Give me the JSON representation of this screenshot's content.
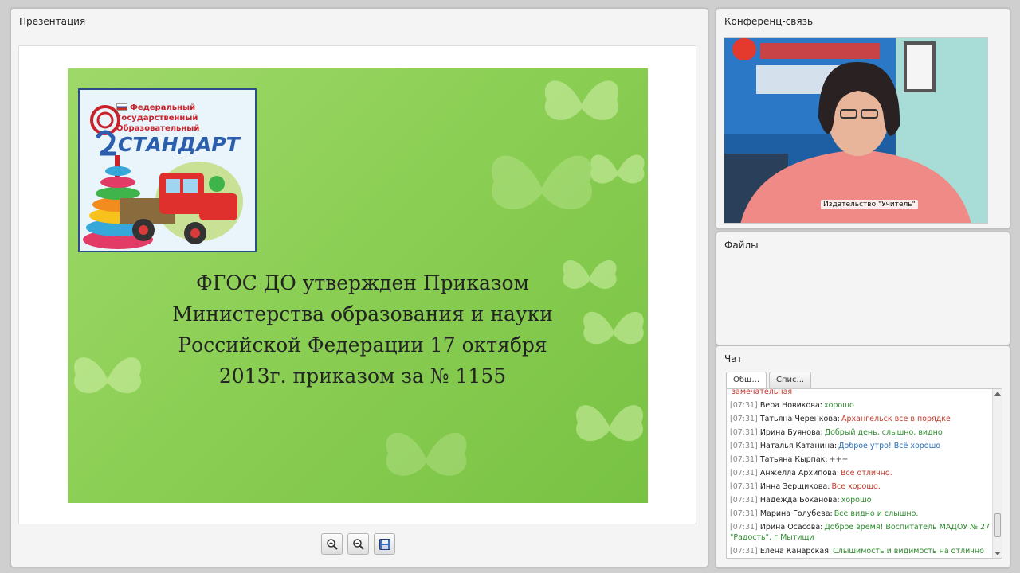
{
  "presentation": {
    "title": "Презентация",
    "slide": {
      "logo": {
        "line1": "Федеральный",
        "line2": "Государственный",
        "line3": "Образовательный",
        "word": "СТАНДАРТ"
      },
      "lines": [
        "ФГОС ДО утвержден Приказом",
        "Министерства образования и науки",
        "Российской Федерации 17 октября",
        "2013г. приказом за № 1155"
      ]
    },
    "toolbar": {
      "zoom_in": "zoom-in-icon",
      "zoom_out": "zoom-out-icon",
      "save": "save-icon"
    }
  },
  "conference": {
    "title": "Конференц-связь",
    "speaker_label": "Издательство \"Учитель\""
  },
  "files": {
    "title": "Файлы"
  },
  "chat": {
    "title": "Чат",
    "tabs": [
      "Общ...",
      "Спис..."
    ],
    "messages": [
      {
        "time": "",
        "name": "",
        "text": "замечательная",
        "color": "#c0392b"
      },
      {
        "time": "[07:31]",
        "name": "Вера Новикова:",
        "text": "хорошо",
        "color": "#2e8b2e"
      },
      {
        "time": "[07:31]",
        "name": "Татьяна Черенкова:",
        "text": "Архангельск все в порядке",
        "color": "#c0392b"
      },
      {
        "time": "[07:31]",
        "name": "Ирина Буянова:",
        "text": "Добрый день, слышно, видно",
        "color": "#2e8b2e"
      },
      {
        "time": "[07:31]",
        "name": "Наталья Катанина:",
        "text": "Доброе утро! Всё хорошо",
        "color": "#2a6fb5"
      },
      {
        "time": "[07:31]",
        "name": "Татьяна Кырпак:",
        "text": "+++",
        "color": "#555555"
      },
      {
        "time": "[07:31]",
        "name": "Анжелла Архипова:",
        "text": "Все отлично.",
        "color": "#c0392b"
      },
      {
        "time": "[07:31]",
        "name": "Инна Зерщикова:",
        "text": "Все хорошо.",
        "color": "#c0392b"
      },
      {
        "time": "[07:31]",
        "name": "Надежда Боканова:",
        "text": "хорошо",
        "color": "#2e8b2e"
      },
      {
        "time": "[07:31]",
        "name": "Марина Голубева:",
        "text": "Все видно и слышно.",
        "color": "#2e8b2e"
      },
      {
        "time": "[07:31]",
        "name": "Ирина Осасова:",
        "text": "Доброе время! Воспитатель МАДОУ № 27 \"Радость\", г.Мытищи",
        "color": "#2e8b2e"
      },
      {
        "time": "[07:31]",
        "name": "Елена Канарская:",
        "text": "Слышимость и видимость на отлично",
        "color": "#2e8b2e"
      }
    ]
  }
}
